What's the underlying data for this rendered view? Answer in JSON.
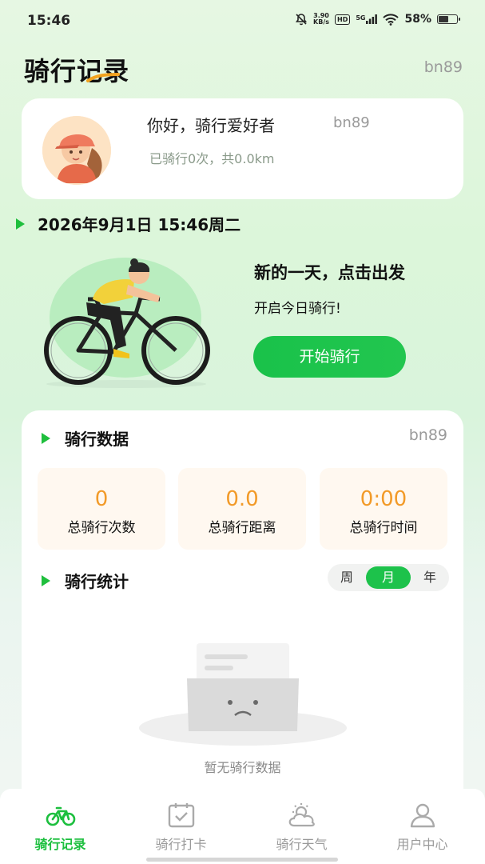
{
  "status_bar": {
    "time": "15:46",
    "net_speed_value": "3.90",
    "net_speed_unit": "KB/s",
    "hd_label": "HD",
    "signal_label": "5G",
    "battery": "58%",
    "battery_level": 0.58
  },
  "header": {
    "title": "骑行记录",
    "username": "bn89"
  },
  "profile": {
    "greeting": "你好，骑行爱好者",
    "username": "bn89",
    "summary": "已骑行0次，共0.0km"
  },
  "date_line": "2026年9月1日 15:46周二",
  "hero": {
    "headline": "新的一天，点击出发",
    "subtitle": "开启今日骑行!",
    "start_button": "开始骑行"
  },
  "ride_data": {
    "title": "骑行数据",
    "username": "bn89",
    "stats": [
      {
        "value": "0",
        "label": "总骑行次数"
      },
      {
        "value": "0.0",
        "label": "总骑行距离"
      },
      {
        "value": "0:00",
        "label": "总骑行时间"
      }
    ]
  },
  "ride_stats": {
    "title": "骑行统计",
    "periods": [
      "周",
      "月",
      "年"
    ],
    "selected_period": "月",
    "empty_text": "暂无骑行数据"
  },
  "bottom_nav": {
    "items": [
      {
        "label": "骑行记录",
        "icon": "bicycle-icon",
        "active": true
      },
      {
        "label": "骑行打卡",
        "icon": "calendar-check-icon",
        "active": false
      },
      {
        "label": "骑行天气",
        "icon": "weather-icon",
        "active": false
      },
      {
        "label": "用户中心",
        "icon": "user-icon",
        "active": false
      }
    ]
  },
  "colors": {
    "accent_green": "#1dc24b",
    "stat_orange": "#f29a28",
    "muted_text": "#9a9a9a"
  }
}
